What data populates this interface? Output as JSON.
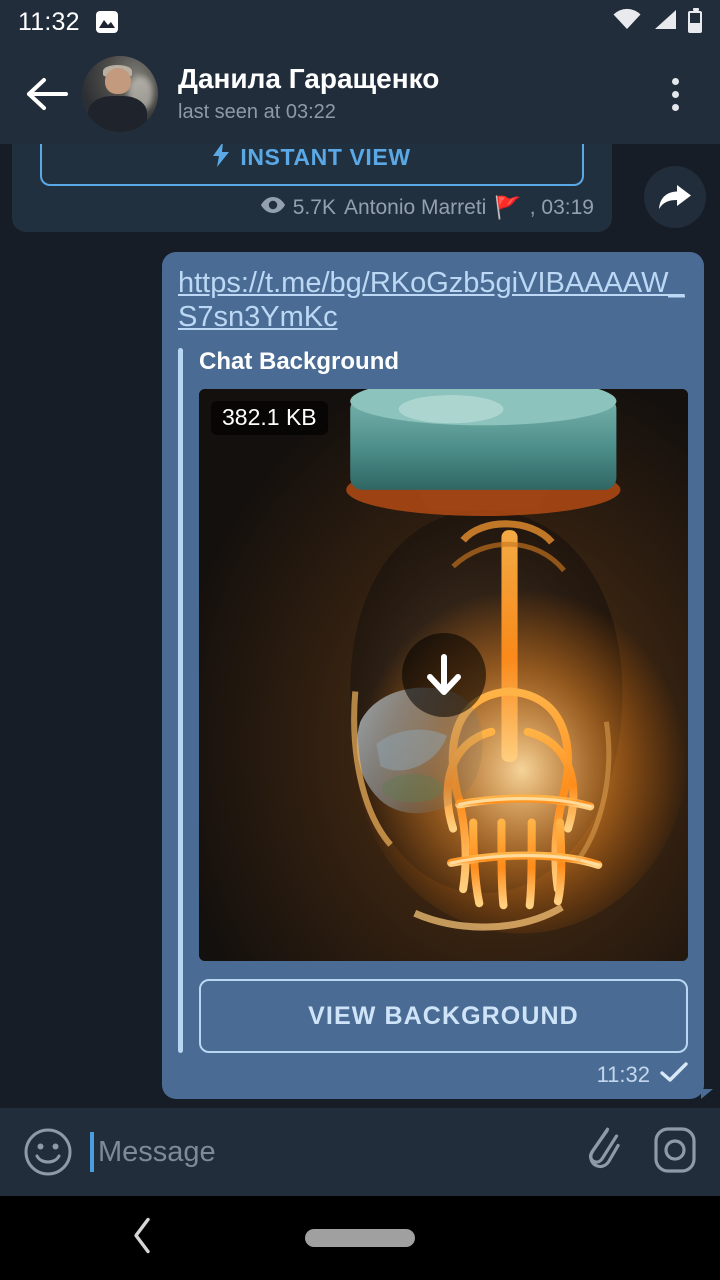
{
  "status_bar": {
    "clock": "11:32",
    "photo_icon": "image-icon",
    "wifi_icon": "wifi-icon",
    "signal_icon": "cellular-signal-icon",
    "battery_icon": "battery-icon"
  },
  "header": {
    "back_icon": "arrow-left-icon",
    "avatar": "contact-avatar",
    "title": "Данила Гаращенко",
    "subtitle": "last seen at 03:22",
    "menu_icon": "overflow-menu-icon"
  },
  "messages": {
    "incoming": {
      "instant_view_label": "INSTANT VIEW",
      "instant_view_icon": "lightning-bolt-icon",
      "views_icon": "eye-icon",
      "views_count": "5.7K",
      "author": "Antonio Marreti",
      "flag": "🚩",
      "time": ", 03:19",
      "forward_icon": "forward-arrow-icon"
    },
    "outgoing": {
      "link": "https://t.me/bg/RKoGzb5giVIBAAAAW_S7sn3YmKc",
      "preview_title": "Chat Background",
      "file_size": "382.1 KB",
      "download_icon": "download-arrow-icon",
      "action_label": "VIEW BACKGROUND",
      "time": "11:32",
      "status_icon": "sent-check-icon"
    }
  },
  "input_bar": {
    "emoji_icon": "smiley-face-icon",
    "placeholder": "Message",
    "value": "",
    "attach_icon": "paperclip-icon",
    "camera_icon": "camera-icon"
  },
  "nav_bar": {
    "back_icon": "chevron-left-icon",
    "home_icon": "home-pill-icon"
  },
  "colors": {
    "chat_background": "#161d27",
    "header": "#222d3c",
    "incoming_bubble": "#21303f",
    "outgoing_bubble": "#4a6c94",
    "accent_link": "#5aa9e6",
    "preview_bar": "#b9d6f2"
  }
}
